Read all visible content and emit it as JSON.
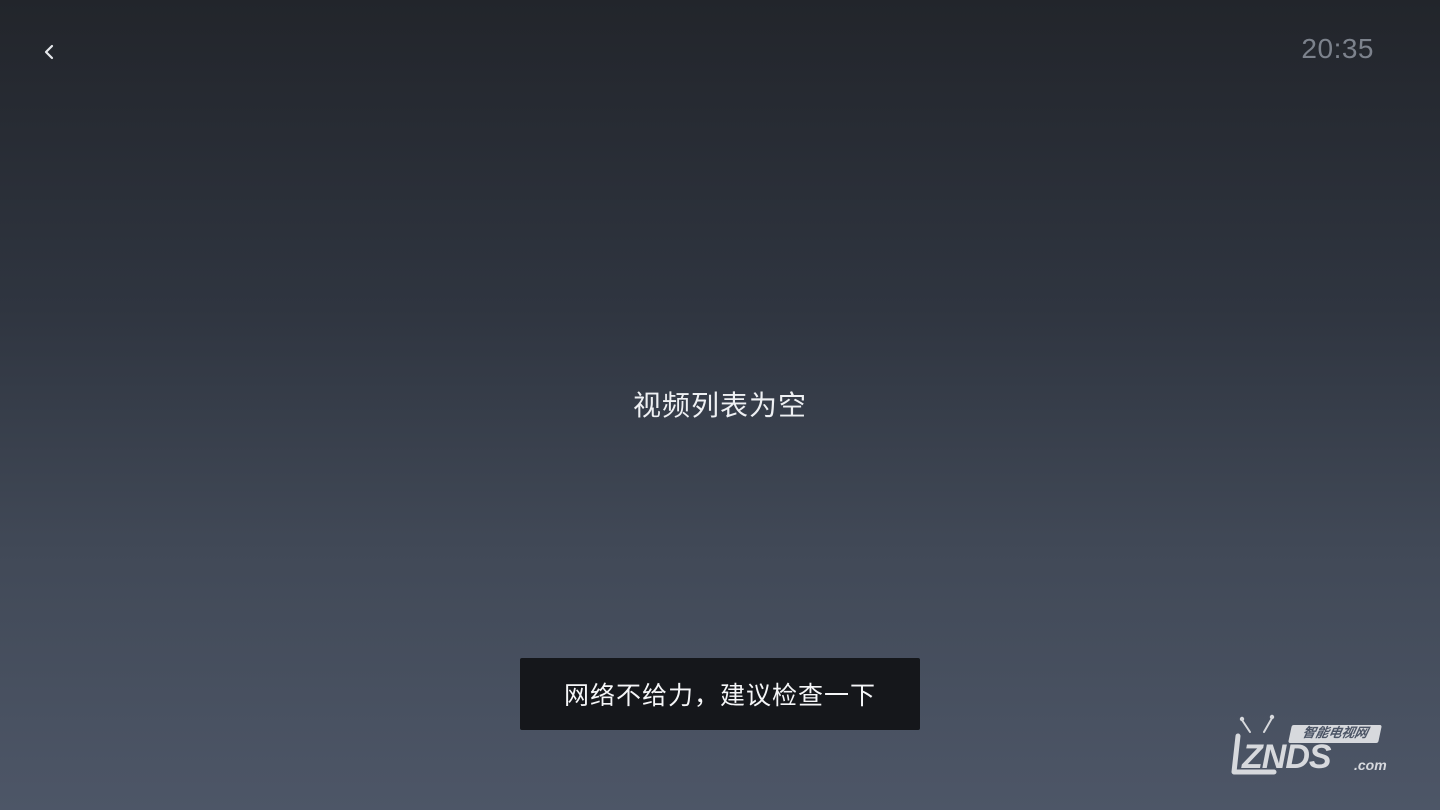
{
  "header": {
    "back_icon": "chevron-left-icon",
    "clock": "20:35"
  },
  "main": {
    "empty_message": "视频列表为空"
  },
  "toast": {
    "message": "网络不给力，建议检查一下"
  },
  "watermark": {
    "label": "智能电视网",
    "brand": "ZNDS",
    "domain": ".com"
  },
  "colors": {
    "background_top": "#22252b",
    "background_bottom": "#4d5667",
    "toast_background": "#15171b",
    "clock_text": "#7c828c",
    "primary_text": "#eef0f3"
  }
}
